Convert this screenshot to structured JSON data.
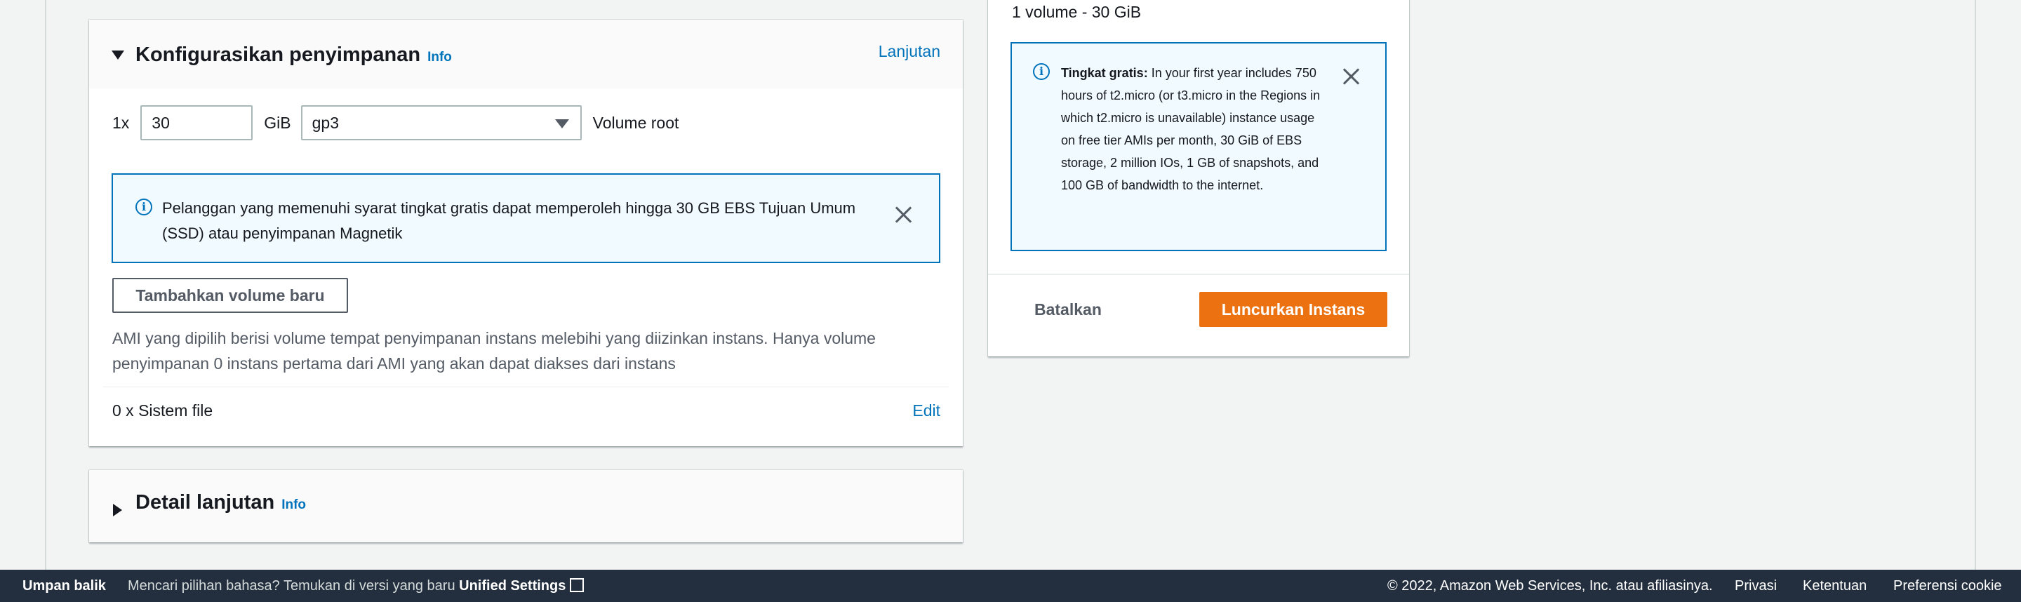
{
  "storage": {
    "title": "Konfigurasikan penyimpanan",
    "info": "Info",
    "advanced_link": "Lanjutan",
    "volume": {
      "count_label": "1x",
      "size_value": "30",
      "unit": "GiB",
      "type_value": "gp3",
      "root_label": "Volume root"
    },
    "free_tier_notice": "Pelanggan yang memenuhi syarat tingkat gratis dapat memperoleh hingga 30 GB EBS Tujuan Umum (SSD) atau penyimpanan Magnetik",
    "add_volume_button": "Tambahkan volume baru",
    "ami_notice": "AMI yang dipilih berisi volume tempat penyimpanan instans melebihi yang diizinkan instans. Hanya volume penyimpanan 0 instans pertama dari AMI yang akan dapat diakses dari instans",
    "file_systems": "0 x Sistem file",
    "edit_link": "Edit"
  },
  "advanced": {
    "title": "Detail lanjutan",
    "info": "Info"
  },
  "summary": {
    "volume_summary": "1 volume - 30 GiB",
    "free_tier": {
      "label": "Tingkat gratis:",
      "text": "In your first year includes 750 hours of t2.micro (or t3.micro in the Regions in which t2.micro is unavailable) instance usage on free tier AMIs per month, 30 GiB of EBS storage, 2 million IOs, 1 GB of snapshots, and 100 GB of bandwidth to the internet."
    },
    "cancel_button": "Batalkan",
    "launch_button": "Luncurkan Instans"
  },
  "footer": {
    "feedback": "Umpan balik",
    "language_prompt": "Mencari pilihan bahasa? Temukan di versi yang baru",
    "unified_settings": "Unified Settings",
    "copyright": "© 2022, Amazon Web Services, Inc. atau afiliasinya.",
    "privacy": "Privasi",
    "terms": "Ketentuan",
    "cookie_preferences": "Preferensi cookie"
  },
  "colors": {
    "accent_link": "#0073bb",
    "primary_button": "#ec7211",
    "footer_bg": "#232f3e",
    "info_bg": "#f1faff"
  }
}
